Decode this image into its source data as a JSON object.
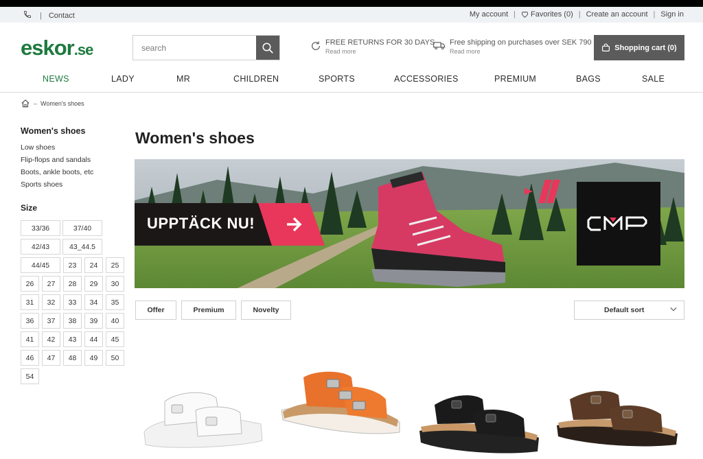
{
  "topbar": {
    "contact": "Contact",
    "my_account": "My account",
    "favorites": "Favorites (0)",
    "create_account": "Create an account",
    "sign_in": "Sign in"
  },
  "header": {
    "logo_main": "eskor",
    "logo_suffix": ".se",
    "search_placeholder": "search",
    "returns_title": "FREE RETURNS FOR 30 DAYS",
    "returns_more": "Read more",
    "shipping_title": "Free shipping on purchases over SEK 790",
    "shipping_more": "Read more",
    "cart_label": "Shopping cart (0)"
  },
  "nav": {
    "items": [
      "NEWS",
      "LADY",
      "MR",
      "CHILDREN",
      "SPORTS",
      "ACCESSORIES",
      "PREMIUM",
      "BAGS",
      "SALE"
    ],
    "active": "NEWS"
  },
  "breadcrumb": {
    "current": "Women's shoes"
  },
  "sidebar": {
    "heading": "Women's shoes",
    "categories": [
      "Low shoes",
      "Flip-flops and sandals",
      "Boots, ankle boots, etc",
      "Sports shoes"
    ],
    "size_heading": "Size",
    "sizes": [
      "33/36",
      "37/40",
      "42/43",
      "43_44.5",
      "44/45",
      "23",
      "24",
      "25",
      "26",
      "27",
      "28",
      "29",
      "30",
      "31",
      "32",
      "33",
      "34",
      "35",
      "36",
      "37",
      "38",
      "39",
      "40",
      "41",
      "42",
      "43",
      "44",
      "45",
      "46",
      "47",
      "48",
      "49",
      "50",
      "54"
    ]
  },
  "main": {
    "title": "Women's shoes",
    "banner": {
      "cta": "UPPTÄCK NU!",
      "brand": "CMP"
    },
    "filters": [
      "Offer",
      "Premium",
      "Novelty"
    ],
    "sort_label": "Default sort"
  },
  "colors": {
    "brand_green": "#1d7a3e",
    "dark_button": "#5b5b5b",
    "banner_pink": "#e8375a",
    "topbar_bg": "#eff2f5"
  },
  "products": [
    {
      "image": "white-double-strap-sandal"
    },
    {
      "image": "orange-triple-buckle-sandal"
    },
    {
      "image": "black-double-strap-sandal"
    },
    {
      "image": "brown-double-strap-sandal"
    }
  ]
}
